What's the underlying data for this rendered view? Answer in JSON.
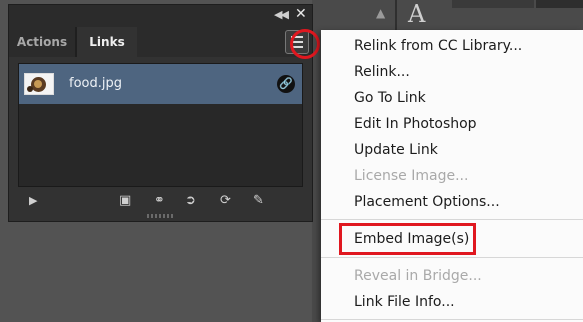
{
  "panel": {
    "tabs": [
      {
        "label": "Actions",
        "active": false
      },
      {
        "label": "Links",
        "active": true
      }
    ],
    "items": [
      {
        "name": "food.jpg",
        "selected": true
      }
    ]
  },
  "flyout_menu": {
    "items": [
      {
        "label": "Relink from CC Library...",
        "enabled": true
      },
      {
        "label": "Relink...",
        "enabled": true
      },
      {
        "label": "Go To Link",
        "enabled": true
      },
      {
        "label": "Edit In Photoshop",
        "enabled": true
      },
      {
        "label": "Update Link",
        "enabled": true
      },
      {
        "label": "License Image...",
        "enabled": false
      },
      {
        "label": "Placement Options...",
        "enabled": true
      },
      {
        "label": "Embed Image(s)",
        "enabled": true,
        "highlighted": true
      },
      {
        "label": "Reveal in Bridge...",
        "enabled": false
      },
      {
        "label": "Link File Info...",
        "enabled": true
      }
    ]
  },
  "workspace": {
    "type_tool_glyph": "A"
  },
  "colors": {
    "highlight_red": "#e0171f",
    "selection_blue": "#4e6580",
    "panel_bg": "#323232",
    "menu_bg": "#fbfbfb"
  },
  "icons": [
    "collapse-icon",
    "close-icon",
    "panel-menu-icon",
    "link-status-icon",
    "play-icon",
    "relink-cc-icon",
    "relink-icon",
    "goto-link-icon",
    "update-link-icon",
    "edit-original-icon"
  ]
}
